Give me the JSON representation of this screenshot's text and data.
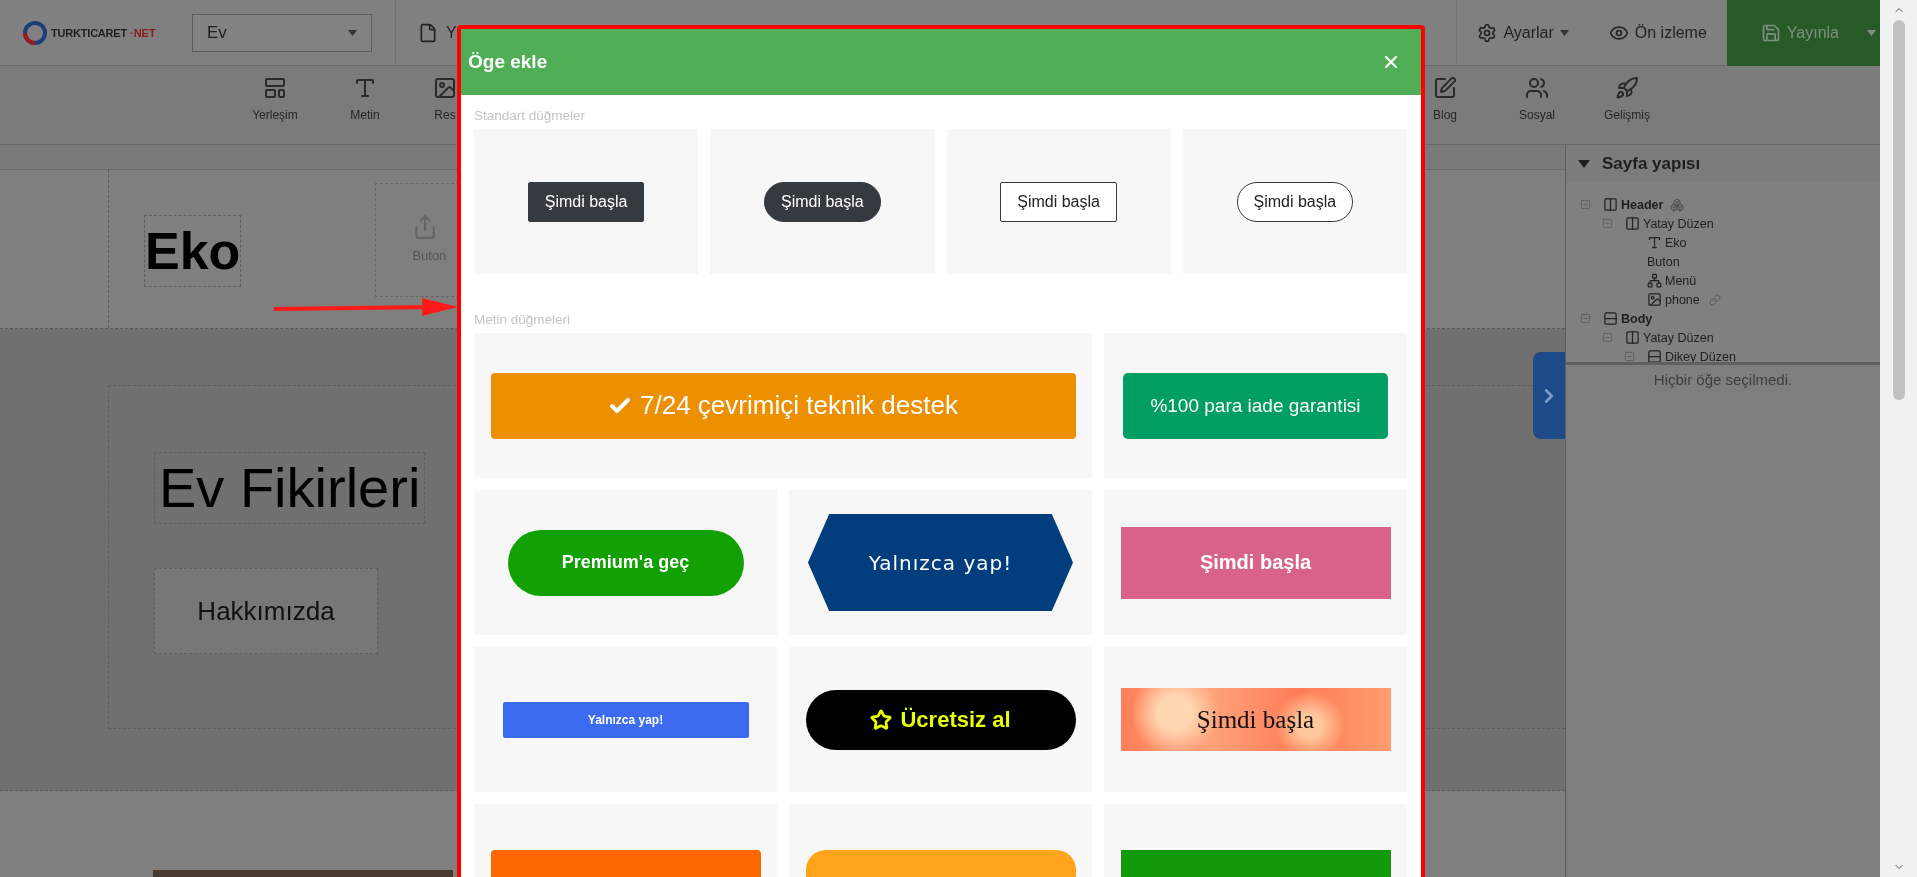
{
  "topbar": {
    "logo": {
      "name": "TURKTICARET",
      "tld": "·NET"
    },
    "page_select": "Ev",
    "page_button": "Y",
    "actions": [
      {
        "kind": "settings",
        "label": "Ayarlar",
        "dropdown": true
      },
      {
        "kind": "preview",
        "label": "Ön izleme",
        "dropdown": false
      },
      {
        "kind": "publish",
        "label": "Yayınla",
        "dropdown": true
      }
    ]
  },
  "toolbar": [
    {
      "kind": "layout",
      "label": "Yerleşim"
    },
    {
      "kind": "text",
      "label": "Metin"
    },
    {
      "kind": "image",
      "label": "Res"
    },
    {
      "kind": "blog",
      "label": "Blog"
    },
    {
      "kind": "social",
      "label": "Sosyal"
    },
    {
      "kind": "advanced",
      "label": "Gelişmiş"
    }
  ],
  "canvas": {
    "logo_text": "Eko",
    "button_widget": "Buton",
    "hero_title": "Ev Fikirleri",
    "hero_button": "Hakkımızda"
  },
  "page_structure": {
    "title": "Sayfa yapısı",
    "expanded": true,
    "tree": [
      {
        "label": "Header",
        "kind": "columns",
        "bold": true,
        "expanded": true,
        "shared": true,
        "children": [
          {
            "label": "Yatay Düzen",
            "kind": "columns",
            "bold": false,
            "expanded": true,
            "children": [
              {
                "label": "Eko",
                "kind": "text",
                "bold": false
              },
              {
                "label": "Buton",
                "kind": "plain",
                "bold": false
              },
              {
                "label": "Menü",
                "kind": "menu",
                "bold": false
              },
              {
                "label": "phone",
                "kind": "image",
                "bold": false,
                "linked": true
              }
            ]
          }
        ]
      },
      {
        "label": "Body",
        "kind": "rows",
        "bold": true,
        "expanded": true,
        "children": [
          {
            "label": "Yatay Düzen",
            "kind": "columns",
            "bold": false,
            "expanded": true,
            "children": [
              {
                "label": "Dikey Düzen",
                "kind": "rows",
                "bold": false,
                "expanded": true
              }
            ]
          }
        ]
      }
    ],
    "empty_note": "Hiçbir öğe seçilmedi."
  },
  "modal": {
    "title": "Öge ekle",
    "sections": [
      {
        "label": "Standart düğmeler",
        "items": [
          {
            "kind": "square",
            "label": "Şimdi başla"
          },
          {
            "kind": "pill",
            "label": "Şimdi başla"
          },
          {
            "kind": "outline",
            "label": "Şimdi başla"
          },
          {
            "kind": "outline-pill",
            "label": "Şimdi başla"
          }
        ]
      },
      {
        "label": "Metin düğmeleri",
        "items": [
          {
            "kind": "wide-check",
            "label": "7/24 çevrimiçi teknik destek"
          },
          {
            "kind": "green-rect",
            "label": "%100 para iade garantisi"
          },
          {
            "kind": "green-pill",
            "label": "Premium'a geç"
          },
          {
            "kind": "hexagon",
            "label": "Yalnızca yap!"
          },
          {
            "kind": "pink",
            "label": "Şimdi başla"
          },
          {
            "kind": "blue-small",
            "label": "Yalnızca yap!"
          },
          {
            "kind": "black-star",
            "label": "Ücretsiz al"
          },
          {
            "kind": "marble",
            "label": "Şimdi başla"
          },
          {
            "kind": "orange-cut"
          },
          {
            "kind": "yellow-cut"
          },
          {
            "kind": "green-cut"
          }
        ]
      }
    ]
  }
}
